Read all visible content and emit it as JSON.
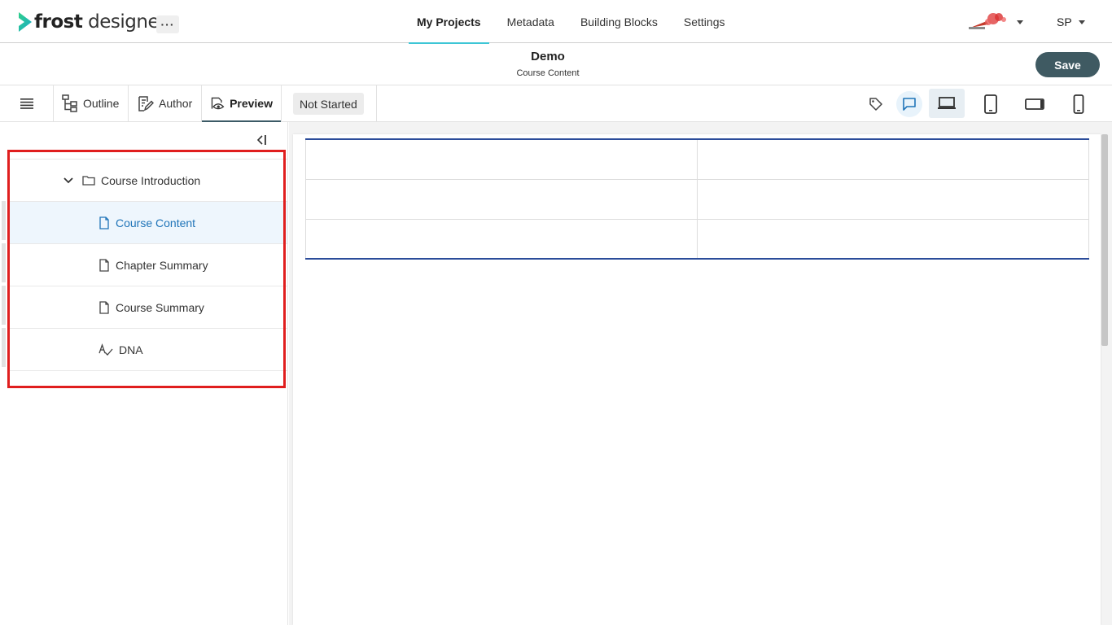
{
  "app": {
    "logo_bold": "frost",
    "logo_light": " designer",
    "more_label": "···"
  },
  "nav": {
    "items": [
      {
        "label": "My Projects",
        "active": true
      },
      {
        "label": "Metadata"
      },
      {
        "label": "Building Blocks"
      },
      {
        "label": "Settings"
      }
    ],
    "user_initials": "SP"
  },
  "header": {
    "title": "Demo",
    "subtitle": "Course Content",
    "save_label": "Save"
  },
  "toolbar": {
    "tabs": [
      {
        "label": "Outline",
        "icon": "outline-tree-icon"
      },
      {
        "label": "Author",
        "icon": "author-edit-icon"
      },
      {
        "label": "Preview",
        "icon": "preview-eye-icon",
        "active": true
      }
    ],
    "status": "Not Started",
    "right_icons": [
      "tag-icon",
      "comment-icon",
      "laptop-icon",
      "tablet-portrait-icon",
      "tablet-landscape-icon",
      "phone-icon"
    ],
    "selected_device": "laptop"
  },
  "tree": {
    "items": [
      {
        "label": "Course Introduction",
        "type": "folder",
        "expanded": true
      },
      {
        "label": "Course Content",
        "type": "page",
        "selected": true
      },
      {
        "label": "Chapter Summary",
        "type": "page"
      },
      {
        "label": "Course Summary",
        "type": "page"
      },
      {
        "label": "DNA",
        "type": "dna"
      }
    ]
  },
  "preview": {
    "table_rows": 3,
    "table_cols": 2
  },
  "colors": {
    "accent_nav": "#3ec6d6",
    "save_button": "#3f5a62",
    "selected_text": "#1f74b8",
    "table_border": "#2b4c9a",
    "highlight": "#e01e1e"
  }
}
